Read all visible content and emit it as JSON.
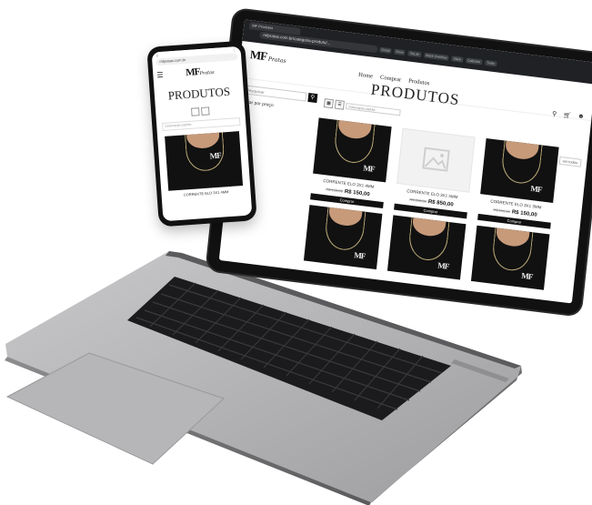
{
  "browser": {
    "tab_label": "MF Produtos",
    "url": "mfpratas.com.br/categoria-produto/...",
    "bookmarks": [
      "Gmail",
      "Drive",
      "GitLab",
      "Stack Overflow",
      "Slack",
      "Calendar",
      "Trello"
    ]
  },
  "site": {
    "logo": "MF",
    "logo_sub": "Pratas",
    "nav": [
      "Home",
      "Comprar",
      "Produtos"
    ],
    "page_title": "PRODUTOS",
    "search_placeholder": "Pesquisar",
    "filter_label": "Filtrar por preço",
    "sort_placeholder": "Ordenação padrão",
    "sale_badge": "ver todos",
    "buy_label": "Comprar",
    "products": [
      {
        "name": "CORRENTE ELO 3X1 4MM",
        "old_price": "R$ 150,00",
        "price": "R$ 150,00",
        "image": "chain-photo"
      },
      {
        "name": "CORRENTE ELO 3X1 5MM",
        "old_price": "R$ 850,00",
        "price": "R$ 850,00",
        "image": "placeholder"
      },
      {
        "name": "CORRENTE ELO 3X1 3MM",
        "old_price": "R$ 150,00",
        "price": "R$ 150,00",
        "image": "chain-photo"
      },
      {
        "name": "",
        "old_price": "",
        "price": "",
        "image": "chain-photo"
      },
      {
        "name": "",
        "old_price": "",
        "price": "",
        "image": "chain-photo"
      },
      {
        "name": "",
        "old_price": "",
        "price": "",
        "image": "chain-photo"
      }
    ]
  },
  "phone": {
    "url": "mfpratas.com.br",
    "page_title": "PRODUTOS",
    "sort_placeholder": "Ordenação padrão",
    "product_name": "CORRENTE ELO 3X1 4MM",
    "home_indicator": "▬"
  },
  "colors": {
    "chrome_bg": "#202124",
    "site_bg": "#ffffff",
    "button_bg": "#111111",
    "laptop_body": "#a9a9ab",
    "keyboard": "#1b1b1d"
  }
}
